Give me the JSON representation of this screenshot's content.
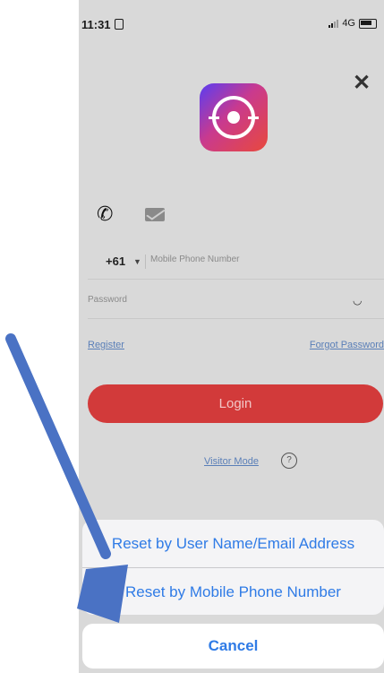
{
  "status_bar": {
    "time": "11:31",
    "network": "4G"
  },
  "login": {
    "country_code": "+61",
    "phone_placeholder": "Mobile Phone Number",
    "password_placeholder": "Password",
    "register_label": "Register",
    "forgot_password_label": "Forgot Password",
    "login_label": "Login",
    "visitor_mode_label": "Visitor Mode",
    "help_label": "?"
  },
  "action_sheet": {
    "options": [
      "Reset by User Name/Email Address",
      "Reset by Mobile Phone Number"
    ],
    "cancel_label": "Cancel"
  },
  "annotation": {
    "arrow_color": "#4a72c4"
  },
  "icons": [
    "close-icon",
    "phone-icon",
    "email-icon",
    "chevron-down-icon",
    "eye-closed-icon",
    "help-icon"
  ]
}
